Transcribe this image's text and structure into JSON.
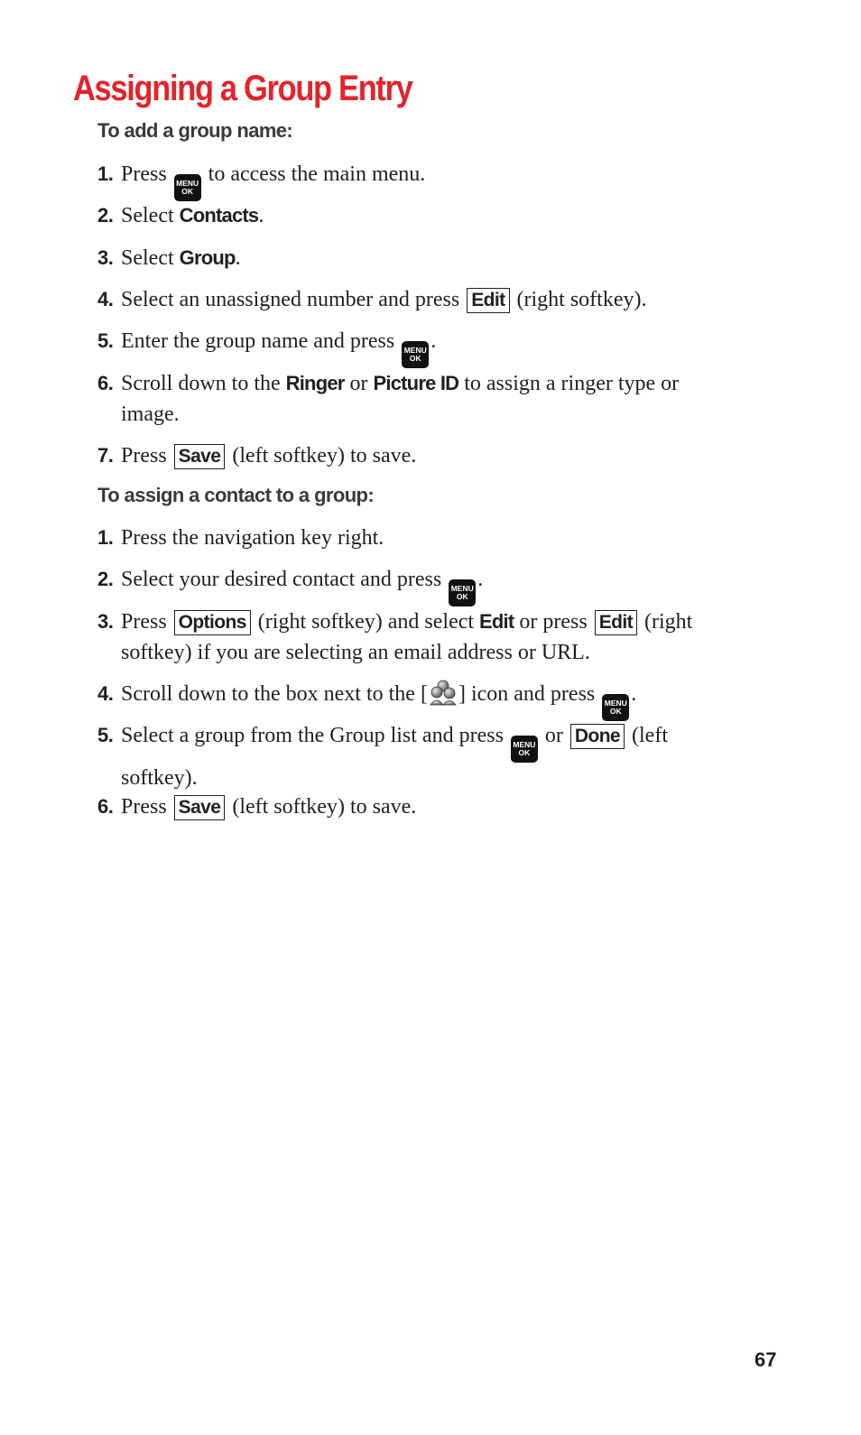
{
  "title": "Assigning a Group Entry",
  "sections": [
    {
      "heading": "To add a group name:",
      "steps": [
        {
          "num": "1.",
          "pre": "Press",
          "post": "to access the main menu."
        },
        {
          "num": "2.",
          "pre": "Select",
          "bold": "Contacts",
          "post": "."
        },
        {
          "num": "3.",
          "pre": "Select",
          "bold": "Group",
          "post": "."
        },
        {
          "num": "4.",
          "pre": "Select an unassigned number and press",
          "softkey": "Edit",
          "post": "(right softkey)."
        },
        {
          "num": "5.",
          "pre": "Enter the group name and press",
          "post": "."
        },
        {
          "num": "6.",
          "pre": "Scroll down to the",
          "bold1": "Ringer",
          "mid": "or",
          "bold2": "Picture ID",
          "post": "to assign a ringer type or image."
        },
        {
          "num": "7.",
          "pre": "Press",
          "softkey": "Save",
          "post": "(left softkey) to save."
        }
      ]
    },
    {
      "heading": "To assign a contact to a group:",
      "steps": [
        {
          "num": "1.",
          "text": "Press the navigation key right."
        },
        {
          "num": "2.",
          "pre": "Select your desired contact and press",
          "post": "."
        },
        {
          "num": "3.",
          "pre": "Press",
          "softkey1": "Options",
          "mid1": "(right softkey) and select",
          "bold": "Edit",
          "mid2": "or press",
          "softkey2": "Edit",
          "post": "(right softkey) if you are selecting an email address or URL."
        },
        {
          "num": "4.",
          "pre": "Scroll down to the box next to the [",
          "mid": "] icon and press",
          "post": "."
        },
        {
          "num": "5.",
          "pre": "Select a group from the Group list and press",
          "mid": "or",
          "softkey": "Done",
          "post": "(left softkey)."
        },
        {
          "num": "6.",
          "pre": "Press",
          "softkey": "Save",
          "post": "(left softkey) to save."
        }
      ]
    }
  ],
  "menu_key": {
    "line1": "MENU",
    "line2": "OK",
    "icon": "menu-ok-key-icon"
  },
  "group_icon": "group-people-icon",
  "page_number": "67",
  "colors": {
    "title": "#e3232b",
    "subhead": "#3a3a3a",
    "text": "#231f20"
  }
}
